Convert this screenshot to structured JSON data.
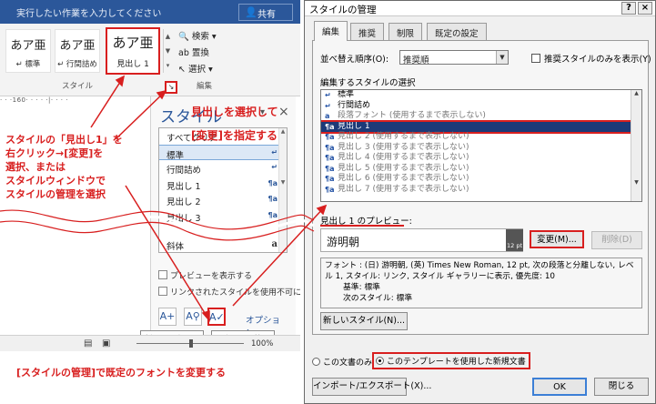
{
  "word": {
    "tell_me": "実行したい作業を入力してください",
    "share": "共有",
    "gallery": [
      {
        "glyph": "あア亜",
        "label": "↵ 標準"
      },
      {
        "glyph": "あア亜",
        "label": "↵ 行間詰め"
      },
      {
        "glyph": "あア亜",
        "label": "見出し 1"
      }
    ],
    "group_style": "スタイル",
    "edit_items": [
      "検索",
      "置換",
      "選択"
    ],
    "group_edit": "編集",
    "ruler": "· · ·160· · · · ·|· · · ·",
    "pane": {
      "title": "スタイル",
      "items": [
        {
          "label": "すべてクリア",
          "mark": ""
        },
        {
          "label": "標準",
          "mark": "↵"
        },
        {
          "label": "行間詰め",
          "mark": "↵"
        },
        {
          "label": "見出し 1",
          "mark": "¶a"
        },
        {
          "label": "見出し 2",
          "mark": "¶a"
        },
        {
          "label": "見出し 3",
          "mark": "¶a"
        },
        {
          "label": "斜体",
          "mark": "a"
        }
      ],
      "show_preview": "プレビューを表示する",
      "disable_linked": "リンクされたスタイルを使用不可にす",
      "options": "オプション...",
      "tip_new": "新しいスタイル",
      "tip_manage": "スタイルの管理"
    },
    "zoom": "100%"
  },
  "callouts": {
    "left": [
      "スタイルの「見出し1」を",
      "右クリック→[変更]を",
      "選択、または",
      "スタイルウィンドウで",
      "スタイルの管理を選択"
    ],
    "bottom": "[スタイルの管理]で既定のフォントを変更する",
    "right": [
      "見出しを選択して",
      "[変更]を指定する"
    ]
  },
  "dialog": {
    "title": "スタイルの管理",
    "help": "?",
    "close": "×",
    "tabs": [
      "編集",
      "推奨",
      "制限",
      "既定の設定"
    ],
    "sort_label": "並べ替え順序(O):",
    "sort_value": "推奨順",
    "recommended_only": "推奨スタイルのみを表示(Y)",
    "select_label": "編集するスタイルの選択",
    "styles": [
      {
        "icon": "↵",
        "label": "標準",
        "gray": false
      },
      {
        "icon": "↵",
        "label": "行間詰め",
        "gray": false
      },
      {
        "icon": "a",
        "label": "段落フォント (使用するまで表示しない)",
        "gray": true
      },
      {
        "icon": "¶a",
        "label": "見出し 1",
        "gray": false,
        "selected": true
      },
      {
        "icon": "¶a",
        "label": "見出し 2 (使用するまで表示しない)",
        "gray": true
      },
      {
        "icon": "¶a",
        "label": "見出し 3 (使用するまで表示しない)",
        "gray": true
      },
      {
        "icon": "¶a",
        "label": "見出し 4 (使用するまで表示しない)",
        "gray": true
      },
      {
        "icon": "¶a",
        "label": "見出し 5 (使用するまで表示しない)",
        "gray": true
      },
      {
        "icon": "¶a",
        "label": "見出し 6 (使用するまで表示しない)",
        "gray": true
      },
      {
        "icon": "¶a",
        "label": "見出し 7 (使用するまで表示しない)",
        "gray": true
      }
    ],
    "preview_label": "見出し 1 のプレビュー:",
    "preview_font": "游明朝",
    "preview_pt": "12 pt",
    "modify": "変更(M)...",
    "delete": "削除(D)",
    "desc": [
      "フォント : (日) 游明朝, (英) Times New Roman, 12 pt, 次の段落と分離しない, レベ",
      "ル 1, スタイル: リンク, スタイル ギャラリーに表示, 優先度: 10",
      "基準: 標準",
      "次のスタイル: 標準"
    ],
    "new_style": "新しいスタイル(N)...",
    "radio_doc": "この文書のみ",
    "radio_template": "このテンプレートを使用した新規文書",
    "import_export": "インポート/エクスポート(X)...",
    "ok": "OK",
    "cancel": "閉じる"
  }
}
